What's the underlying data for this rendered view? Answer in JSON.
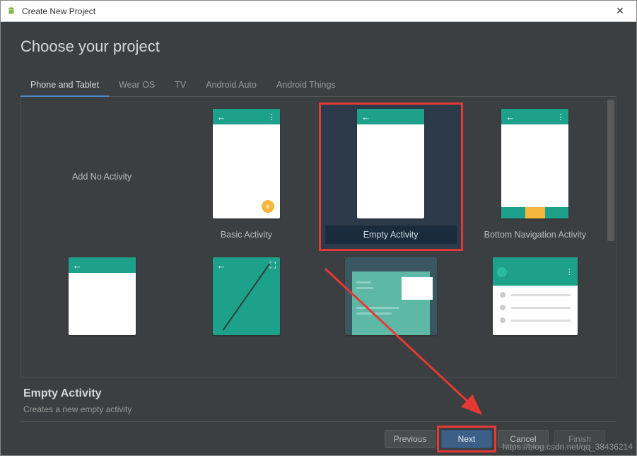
{
  "window": {
    "title": "Create New Project"
  },
  "heading": "Choose your project",
  "tabs": [
    {
      "label": "Phone and Tablet",
      "active": true
    },
    {
      "label": "Wear OS",
      "active": false
    },
    {
      "label": "TV",
      "active": false
    },
    {
      "label": "Android Auto",
      "active": false
    },
    {
      "label": "Android Things",
      "active": false
    }
  ],
  "templates": [
    {
      "label": "Add No Activity",
      "kind": "none"
    },
    {
      "label": "Basic Activity",
      "kind": "basic"
    },
    {
      "label": "Empty Activity",
      "kind": "empty",
      "selected": true
    },
    {
      "label": "Bottom Navigation Activity",
      "kind": "bottomnav"
    },
    {
      "label": "",
      "kind": "empty2"
    },
    {
      "label": "",
      "kind": "fullscreen"
    },
    {
      "label": "",
      "kind": "scrolling"
    },
    {
      "label": "",
      "kind": "masterdetail"
    }
  ],
  "detail": {
    "title": "Empty Activity",
    "description": "Creates a new empty activity"
  },
  "buttons": {
    "previous": "Previous",
    "next": "Next",
    "cancel": "Cancel",
    "finish": "Finish"
  },
  "watermark": "https://blog.csdn.net/qq_38436214",
  "colors": {
    "accent_teal": "#1ea18a",
    "highlight_red": "#e53935",
    "primary_blue": "#3b5f86",
    "tab_underline": "#4a88c7"
  }
}
